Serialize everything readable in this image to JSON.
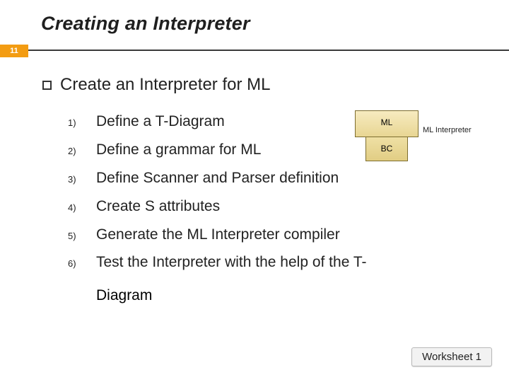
{
  "title": "Creating an Interpreter",
  "page_number": "11",
  "lead": "Create an Interpreter for ML",
  "items": [
    {
      "num": "1)",
      "text": "Define a T-Diagram"
    },
    {
      "num": "2)",
      "text": "Define a grammar for ML"
    },
    {
      "num": "3)",
      "text": "Define Scanner and Parser definition"
    },
    {
      "num": "4)",
      "text": "Create S attributes"
    },
    {
      "num": "5)",
      "text": "Generate the ML Interpreter compiler"
    },
    {
      "num": "6)",
      "text": "Test the Interpreter with the help of the T-"
    }
  ],
  "item6_cont": "Diagram",
  "tdiagram": {
    "top": "ML",
    "bottom": "BC",
    "caption": "ML Interpreter"
  },
  "worksheet_label": "Worksheet 1"
}
